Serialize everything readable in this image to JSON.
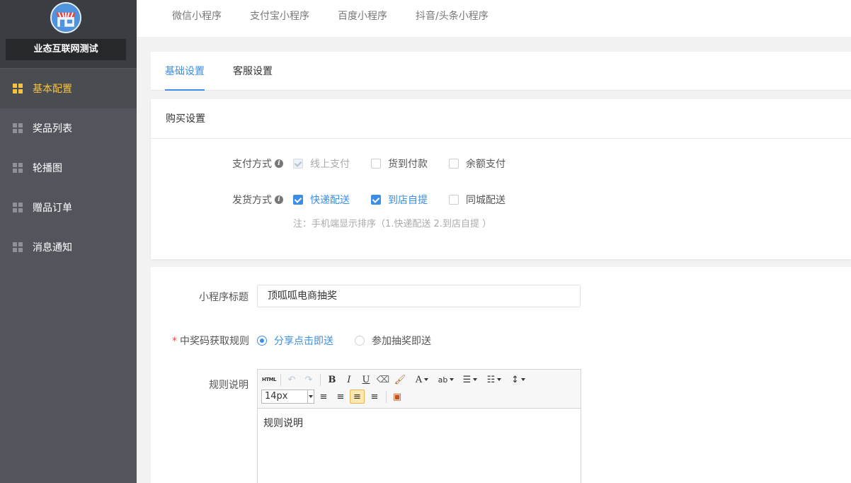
{
  "sidebar": {
    "shop_name": "业态互联网测试",
    "items": [
      {
        "label": "基本配置",
        "active": true
      },
      {
        "label": "奖品列表"
      },
      {
        "label": "轮播图"
      },
      {
        "label": "赠品订单"
      },
      {
        "label": "消息通知"
      }
    ]
  },
  "top_tabs": [
    "微信小程序",
    "支付宝小程序",
    "百度小程序",
    "抖音/头条小程序"
  ],
  "sub_tabs": [
    "基础设置",
    "客服设置"
  ],
  "purchase": {
    "title": "购买设置",
    "pay_label": "支付方式",
    "pay_options": [
      "线上支付",
      "货到付款",
      "余额支付"
    ],
    "ship_label": "发货方式",
    "ship_options": [
      "快递配送",
      "到店自提",
      "同城配送"
    ],
    "note": "注：手机端显示排序（1.快递配送 2.到店自提 ）"
  },
  "form": {
    "title_label": "小程序标题",
    "title_value": "顶呱呱电商抽奖",
    "rule_label": "中奖码获取规则",
    "rule_options": [
      "分享点击即送",
      "参加抽奖即送"
    ],
    "desc_label": "规则说明",
    "editor": {
      "font_size": "14px",
      "content": "规则说明",
      "html_btn": "HTML"
    }
  },
  "colors": {
    "accent": "#3a8ee6",
    "active_nav": "#f5c242",
    "sidebar": "#52565c"
  }
}
